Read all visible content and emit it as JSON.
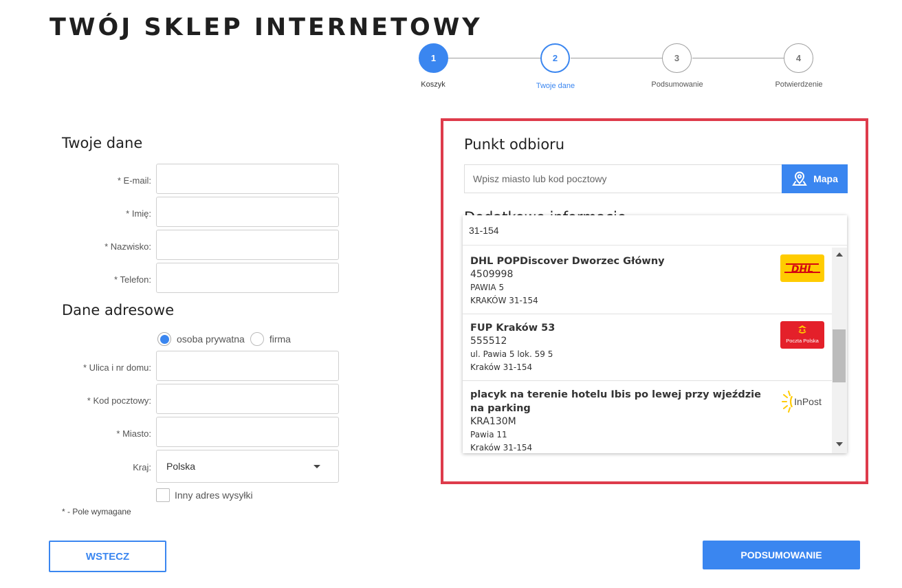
{
  "shop_title": "TWÓJ SKLEP INTERNETOWY",
  "stepper": {
    "steps": [
      {
        "number": "1",
        "label": "Koszyk",
        "state": "done"
      },
      {
        "number": "2",
        "label": "Twoje dane",
        "state": "active"
      },
      {
        "number": "3",
        "label": "Podsumowanie",
        "state": "pending"
      },
      {
        "number": "4",
        "label": "Potwierdzenie",
        "state": "pending"
      }
    ]
  },
  "personal": {
    "title": "Twoje dane",
    "email_label": "* E-mail:",
    "first_name_label": "* Imię:",
    "last_name_label": "* Nazwisko:",
    "phone_label": "* Telefon:"
  },
  "address": {
    "title": "Dane adresowe",
    "radio_private": "osoba prywatna",
    "radio_company": "firma",
    "street_label": "* Ulica i nr domu:",
    "postal_label": "* Kod pocztowy:",
    "city_label": "* Miasto:",
    "country_label": "Kraj:",
    "country_value": "Polska",
    "other_address_label": "Inny adres wysyłki",
    "required_note": "* - Pole wymagane"
  },
  "buttons": {
    "back": "WSTECZ",
    "summary": "PODSUMOWANIE"
  },
  "pickup": {
    "title": "Punkt odbioru",
    "search_placeholder": "Wpisz miasto lub kod pocztowy",
    "map_button": "Mapa",
    "extra_heading": "Dodatkowe informacje",
    "dropdown_query": "31-154",
    "results": [
      {
        "name": "DHL POPDiscover Dworzec Główny",
        "code": "4509998",
        "line1": "PAWIA 5",
        "line2": "KRAKÓW 31-154",
        "logo": "dhl-logo"
      },
      {
        "name": "FUP Kraków 53",
        "code": "555512",
        "line1": "ul. Pawia 5 lok. 59 5",
        "line2": "Kraków 31-154",
        "logo": "poczta-polska-logo"
      },
      {
        "name": "placyk na terenie hotelu Ibis po lewej przy wjeździe na parking",
        "code": "KRA130M",
        "line1": "Pawia 11",
        "line2": "Kraków 31-154",
        "logo": "inpost-logo"
      }
    ],
    "logo_texts": {
      "dhl": "DHL",
      "poczta": "Poczta Polska",
      "inpost": "InPost"
    }
  },
  "colors": {
    "accent": "#3a86f0",
    "highlight_border": "#de3b4b",
    "dhl_yellow": "#ffcc00",
    "dhl_red": "#d40511",
    "poczta_red": "#e4202a",
    "inpost_yellow": "#ffcb04"
  }
}
